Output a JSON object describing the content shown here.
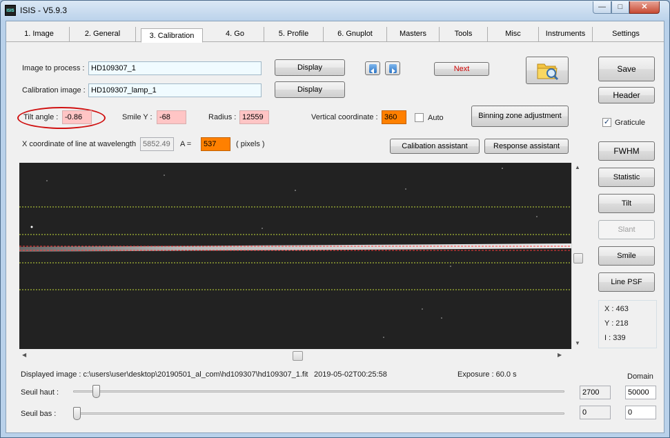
{
  "window": {
    "title": "ISIS - V5.9.3",
    "icon_label": "ISIS"
  },
  "tabs": [
    {
      "label": "1. Image"
    },
    {
      "label": "2. General"
    },
    {
      "label": "3. Calibration"
    },
    {
      "label": "4. Go"
    },
    {
      "label": "5. Profile"
    },
    {
      "label": "6. Gnuplot"
    },
    {
      "label": "Masters"
    },
    {
      "label": "Tools"
    },
    {
      "label": "Misc"
    },
    {
      "label": "Instruments"
    },
    {
      "label": "Settings"
    }
  ],
  "active_tab": "3. Calibration",
  "form": {
    "image_to_process_label": "Image to process :",
    "image_to_process_value": "HD109307_1",
    "calibration_image_label": "Calibration image :",
    "calibration_image_value": "HD109307_lamp_1",
    "display_label": "Display",
    "next_label": "Next",
    "tilt_label": "Tilt angle :",
    "tilt_value": "-0.86",
    "smile_label": "Smile Y :",
    "smile_value": "-68",
    "radius_label": "Radius :",
    "radius_value": "12559",
    "vertical_label": "Vertical coordinate :",
    "vertical_value": "360",
    "auto_label": "Auto",
    "binning_label": "Binning zone adjustment",
    "xcoord_label": "X coordinate of line at wavelength",
    "xcoord_value": "5852.49",
    "a_label": "A =",
    "a_value": "537",
    "pixels_label": "( pixels )",
    "calibration_assistant_label": "Calibation assistant",
    "response_assistant_label": "Response assistant"
  },
  "right_panel": {
    "save_label": "Save",
    "header_label": "Header",
    "graticule_label": "Graticule",
    "graticule_checked": "✓",
    "fwhm_label": "FWHM",
    "statistic_label": "Statistic",
    "tilt_label": "Tilt",
    "slant_label": "Slant",
    "smile_label": "Smile",
    "line_psf_label": "Line PSF",
    "x_readout": "X : 463",
    "y_readout": "Y : 218",
    "i_readout": "I : 339"
  },
  "status": {
    "displayed_image": "Displayed image : c:\\users\\user\\desktop\\20190501_al_com\\hd109307\\hd109307_1.fit",
    "timestamp": "2019-05-02T00:25:58",
    "exposure": "Exposure : 60.0 s",
    "domain_label": "Domain",
    "seuil_haut_label": "Seuil haut :",
    "seuil_haut_value": "2700",
    "seuil_haut_domain": "50000",
    "seuil_haut_fraction": 0.04,
    "seuil_bas_label": "Seuil bas :",
    "seuil_bas_value": "0",
    "seuil_bas_domain": "0",
    "seuil_bas_fraction": 0.0
  },
  "colors": {
    "tilt_highlight": "#d01010",
    "pink_field": "#ffc5c5",
    "orange_field": "#ff8000",
    "guide_lines": "#c8e03a",
    "spectrum_line": "#ff3b3b"
  }
}
